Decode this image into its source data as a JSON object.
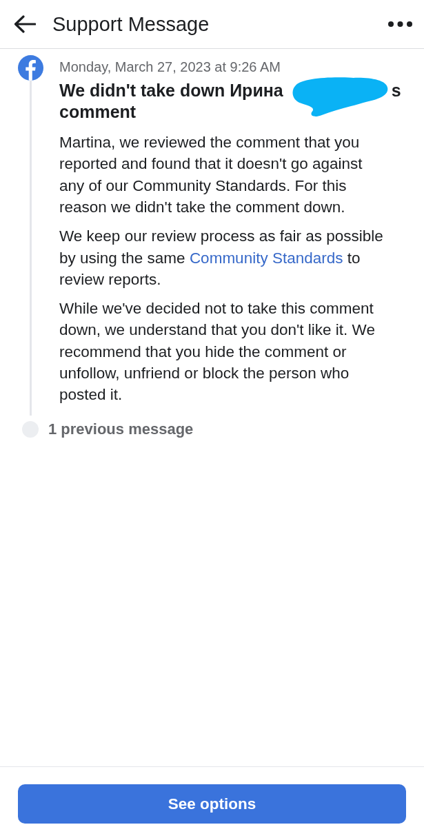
{
  "header": {
    "title": "Support Message"
  },
  "message": {
    "timestamp": "Monday, March 27, 2023 at 9:26 AM",
    "title": {
      "start": "We didn't take down Ирина",
      "redacted": true,
      "end": "s",
      "last_line": "comment"
    },
    "paragraphs": [
      {
        "text": "Martina, we reviewed the comment that you reported and found that it doesn't go against any of our Community Standards. For this reason we didn't take the comment down."
      },
      {
        "text": "We keep our review process as fair as possible by using the same",
        "link": "Community Standards",
        "after": "to review reports."
      },
      {
        "text": "While we've decided not to take this comment down, we understand that you don't like it. We recommend that you hide the comment or unfollow, unfriend or block the person who posted it."
      }
    ]
  },
  "previous_messages": {
    "label": "1 previous message"
  },
  "footer": {
    "button": "See options"
  }
}
